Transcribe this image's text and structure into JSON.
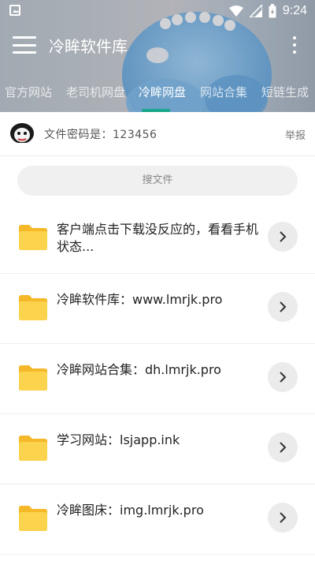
{
  "status_bar": {
    "time": "9:24"
  },
  "toolbar": {
    "title": "冷眸软件库"
  },
  "tabs": [
    {
      "label": "官方网站"
    },
    {
      "label": "老司机网盘"
    },
    {
      "label": "冷眸网盘",
      "active": true
    },
    {
      "label": "网站合集"
    },
    {
      "label": "短链生成"
    }
  ],
  "notice": {
    "text": "文件密码是：123456",
    "report_label": "举报"
  },
  "search": {
    "placeholder": "搜文件"
  },
  "files": [
    {
      "name": "客户端点击下载没反应的，看看手机状态..."
    },
    {
      "name": "冷眸软件库：www.lmrjk.pro"
    },
    {
      "name": "冷眸网站合集：dh.lmrjk.pro"
    },
    {
      "name": "学习网站：lsjapp.ink"
    },
    {
      "name": "冷眸图床：img.lmrjk.pro"
    }
  ],
  "colors": {
    "accent": "#19a68b",
    "folder": "#fcd34d",
    "folder_dark": "#f5b829"
  }
}
